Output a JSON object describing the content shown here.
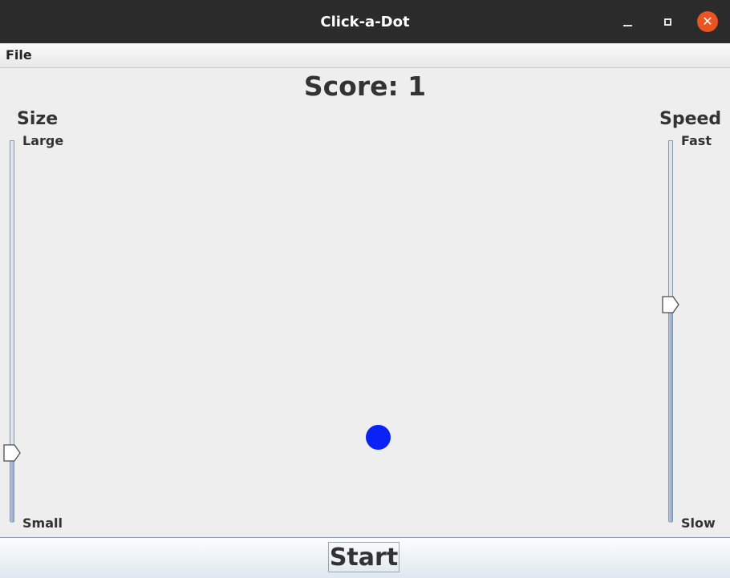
{
  "window": {
    "title": "Click-a-Dot",
    "controls": {
      "minimize_icon": "minimize-icon",
      "maximize_icon": "maximize-icon",
      "close_icon": "close-icon",
      "close_glyph": "✕",
      "close_color": "#e95420"
    }
  },
  "menu": {
    "items": [
      {
        "label": "File"
      }
    ]
  },
  "score": {
    "text": "Score: 1"
  },
  "size_slider": {
    "title": "Size",
    "max_label": "Large",
    "min_label": "Small",
    "value_fraction": 0.18
  },
  "speed_slider": {
    "title": "Speed",
    "max_label": "Fast",
    "min_label": "Slow",
    "value_fraction": 0.57
  },
  "dot": {
    "color": "#0a22f5"
  },
  "start_button": {
    "label": "Start"
  }
}
